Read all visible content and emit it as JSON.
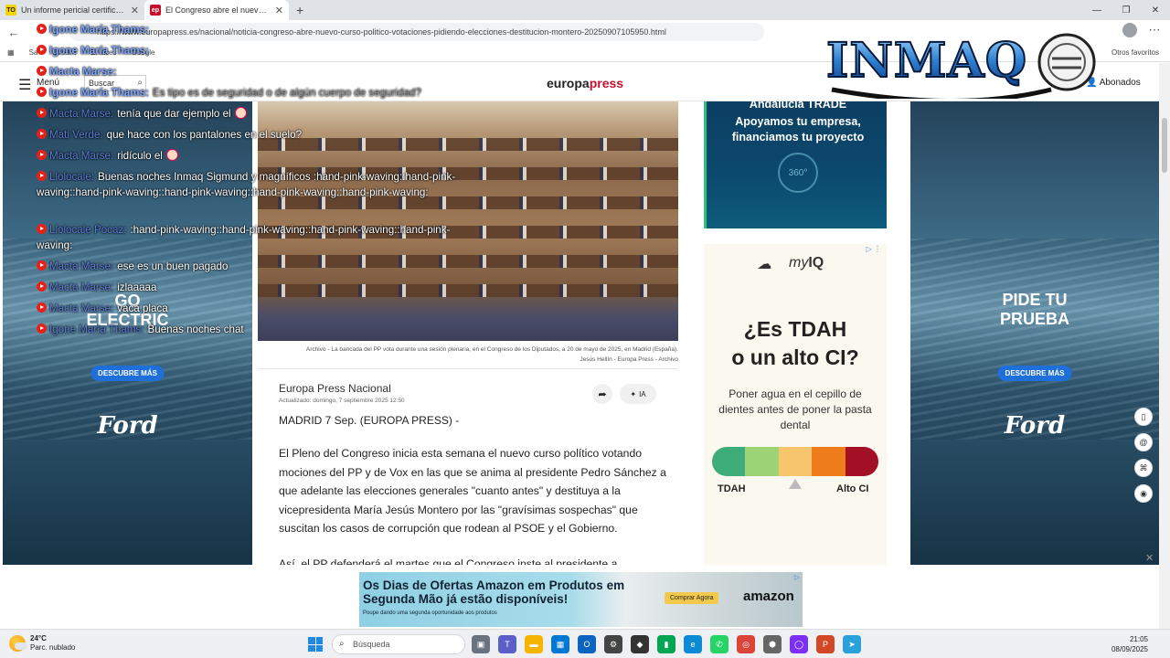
{
  "browser": {
    "tabs": [
      {
        "favicon": "TO",
        "title": "Un informe pericial certifica que",
        "active": false
      },
      {
        "favicon": "ep",
        "title": "El Congreso abre el nuevo curso",
        "active": true
      }
    ],
    "new_tab": "+",
    "url": "https://www.europapress.es/nacional/noticia-congreso-abre-nuevo-curso-politico-votaciones-pidiendo-elecciones-destitucion-montero-20250907105950.html",
    "bookmarks": [
      "Sa",
      "Stream",
      "Enlaces",
      "Google"
    ],
    "bookmarks_right": "Otros favoritos"
  },
  "site": {
    "menu_label": "Menú",
    "search_placeholder": "Buscar",
    "logo_left": "europa",
    "logo_right": "press",
    "subscribers": "Abonados"
  },
  "side_ads": {
    "left_title_1": "GO",
    "left_title_2": "ELECTRIC",
    "left_button": "DESCUBRE MÁS",
    "left_brand": "Ford",
    "right_title_1": "PIDE TU",
    "right_title_2": "PRUEBA",
    "right_button": "DESCUBRE MÁS",
    "right_brand": "Ford"
  },
  "article": {
    "caption_1": "Archivo - La bancada del PP vota durante una sesión plenaria, en el Congreso de los Diputados, a 20 de mayo de 2025, en Madrid (España).",
    "caption_2": "Jesús Hellín - Europa Press - Archivo",
    "author": "Europa Press Nacional",
    "updated": "Actualizado: domingo, 7 septiembre 2025 12:50",
    "ia_label": "IA",
    "dateline": "MADRID 7 Sep. (EUROPA PRESS) -",
    "paragraph_1": "El Pleno del Congreso inicia esta semana el nuevo curso político votando mociones del PP y de Vox en las que se anima al presidente Pedro Sánchez a que adelante las elecciones generales \"cuanto antes\" y destituya a la vicepresidenta María Jesús Montero por las \"gravísimas sospechas\" que suscitan los casos de corrupción que rodean al PSOE y el Gobierno.",
    "paragraph_2": "Así, el PP defenderá el martes que el Congreso inste al presidente a"
  },
  "right_ads": {
    "andalucia_1": "Andalucía TRADE",
    "andalucia_2": "Apoyamos tu empresa,",
    "andalucia_3": "financiamos tu proyecto",
    "andalucia_360": "360°",
    "myiq_brand_1": "my",
    "myiq_brand_2": "IQ",
    "headline_1": "¿Es TDAH",
    "headline_2": "o un alto CI?",
    "sub": "Poner agua en el cepillo de dientes antes de poner la pasta dental",
    "scale_colors": [
      "#3dac78",
      "#9dd475",
      "#f6c56e",
      "#ef7c1a",
      "#a30f25"
    ],
    "left_label": "TDAH",
    "right_label": "Alto CI"
  },
  "bottom_ad": {
    "title": "Os Dias de Ofertas Amazon em Produtos em Segunda Mão já estão disponíveis!",
    "sub": "Poupe dando uma segunda oportunidade aos produtos",
    "cta": "Comprar Agora",
    "brand": "amazon"
  },
  "chat": [
    {
      "author": "Igone María Thams:",
      "text": "",
      "faint": true
    },
    {
      "author": "Igone María Thams:",
      "text": "",
      "faint": true
    },
    {
      "author": "Macta Marse:",
      "text": "",
      "faint": true
    },
    {
      "author": "Igone María Thams:",
      "text": "Es tipo es de seguridad o de algún cuerpo de seguridad?",
      "faint": true
    },
    {
      "author": "Macta Marse:",
      "text": "tenía que dar ejemplo el",
      "emoji": "clown"
    },
    {
      "author": "Mati Verde:",
      "text": "que hace con los pantalones en el suelo?"
    },
    {
      "author": "Macta Marse:",
      "text": "ridículo el",
      "emoji": "clown"
    },
    {
      "author": "Llolocale:",
      "text": "Buenas noches Inmaq Sigmund y magníficos :hand-pink-waving::hand-pink-waving::hand-pink-waving::hand-pink-waving::hand-pink-waving::hand-pink-waving:",
      "wrap": true
    },
    {
      "author": "Llolocale Pocaz:",
      "text": ":hand-pink-waving::hand-pink-waving::hand-pink-waving::hand-pink-waving:",
      "wrap": true
    },
    {
      "author": "Macta Marse:",
      "text": "ese es un buen pagado"
    },
    {
      "author": "Macta Marse:",
      "text": "izlaaaaa"
    },
    {
      "author": "Macta Marse:",
      "text": "vaca placa"
    },
    {
      "author": "Igone María Thams:",
      "text": "Buenas noches chat"
    }
  ],
  "overlay_logo": "INMAQ",
  "taskbar": {
    "temp": "24°C",
    "weather": "Parc. nublado",
    "search": "Búsqueda",
    "time": "21:05",
    "date": "08/09/2025"
  }
}
